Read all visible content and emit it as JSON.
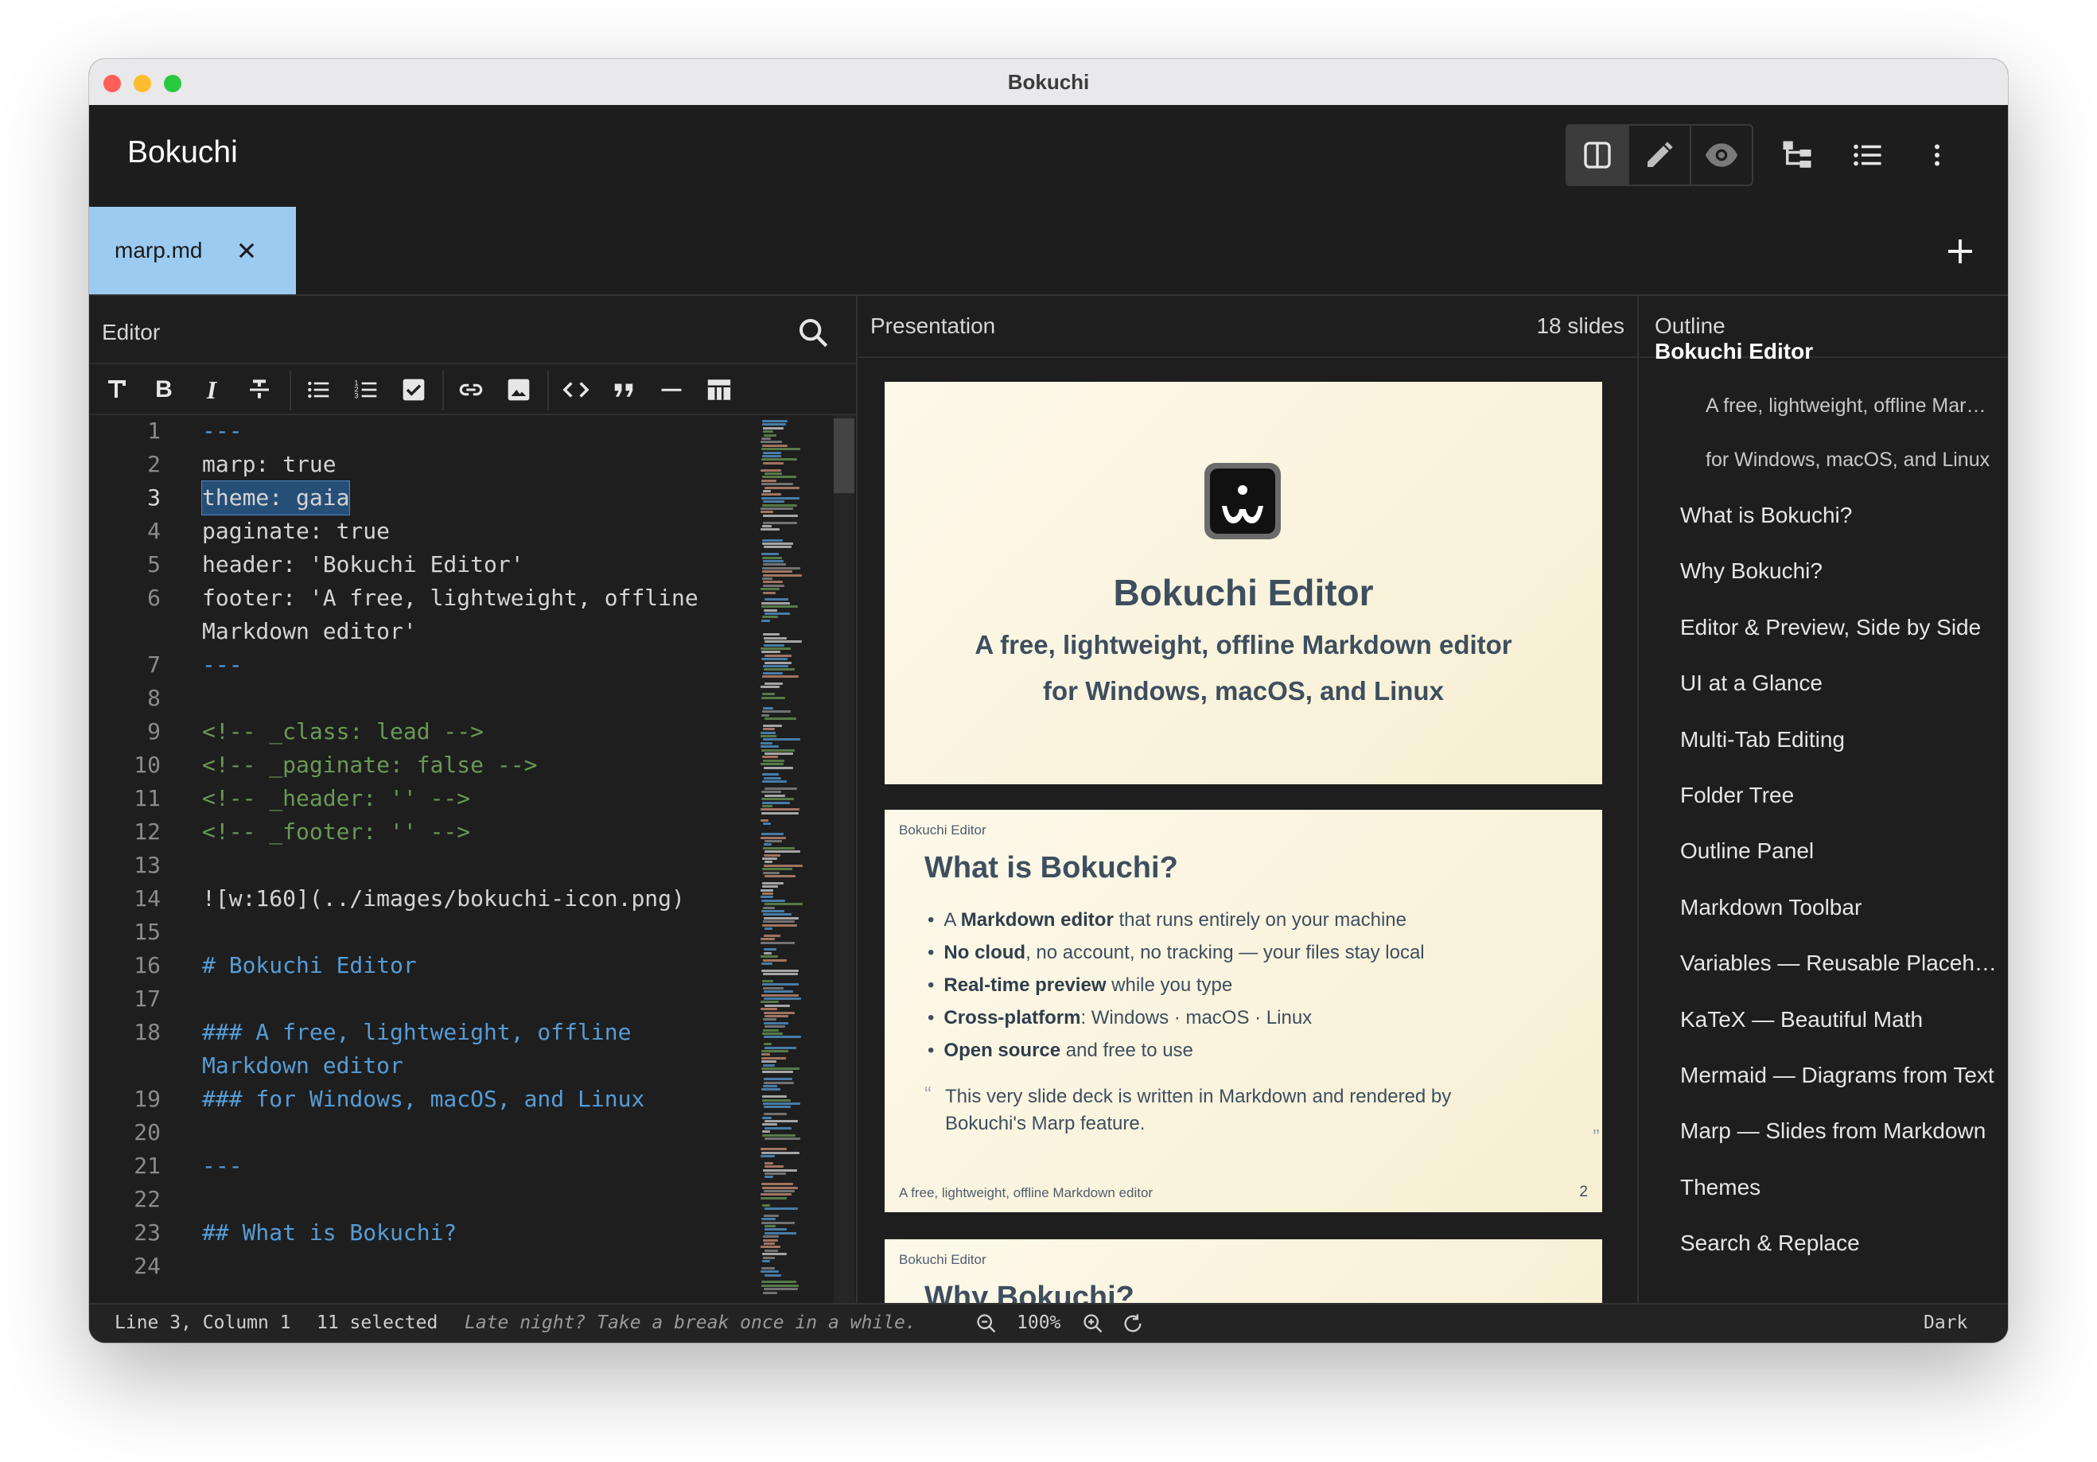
{
  "window": {
    "title": "Bokuchi"
  },
  "app": {
    "title": "Bokuchi"
  },
  "toolbar_icons": [
    "split-view-icon",
    "pencil-icon",
    "eye-icon",
    "folder-tree-icon",
    "outline-list-icon",
    "more-vertical-icon"
  ],
  "tabs": [
    {
      "label": "marp.md",
      "active": true
    }
  ],
  "editor": {
    "title": "Editor",
    "format_buttons": [
      "text-style-icon",
      "bold-icon",
      "italic-icon",
      "strikethrough-icon",
      "bullet-list-icon",
      "numbered-list-icon",
      "checkbox-icon",
      "link-icon",
      "image-icon",
      "code-icon",
      "quote-icon",
      "horizontal-rule-icon",
      "table-icon"
    ],
    "lines": [
      {
        "n": "1",
        "text": "---",
        "kind": "dash"
      },
      {
        "n": "2",
        "text": "marp: true",
        "kind": "plain"
      },
      {
        "n": "3",
        "text": "theme: gaia",
        "kind": "selected"
      },
      {
        "n": "4",
        "text": "paginate: true",
        "kind": "plain"
      },
      {
        "n": "5",
        "text": "header: 'Bokuchi Editor'",
        "kind": "plain"
      },
      {
        "n": "6",
        "text": "footer: 'A free, lightweight, offline",
        "kind": "plain"
      },
      {
        "n": "",
        "text": "Markdown editor'",
        "kind": "plain"
      },
      {
        "n": "7",
        "text": "---",
        "kind": "dash"
      },
      {
        "n": "8",
        "text": "",
        "kind": "plain"
      },
      {
        "n": "9",
        "text": "<!-- _class: lead -->",
        "kind": "comment"
      },
      {
        "n": "10",
        "text": "<!-- _paginate: false -->",
        "kind": "comment"
      },
      {
        "n": "11",
        "text": "<!-- _header: '' -->",
        "kind": "comment"
      },
      {
        "n": "12",
        "text": "<!-- _footer: '' -->",
        "kind": "comment"
      },
      {
        "n": "13",
        "text": "",
        "kind": "plain"
      },
      {
        "n": "14",
        "text": "![w:160](../images/bokuchi-icon.png)",
        "kind": "image"
      },
      {
        "n": "15",
        "text": "",
        "kind": "plain"
      },
      {
        "n": "16",
        "text": "# Bokuchi Editor",
        "kind": "head"
      },
      {
        "n": "17",
        "text": "",
        "kind": "plain"
      },
      {
        "n": "18",
        "text": "### A free, lightweight, offline",
        "kind": "head"
      },
      {
        "n": "",
        "text": "Markdown editor",
        "kind": "head"
      },
      {
        "n": "19",
        "text": "### for Windows, macOS, and Linux",
        "kind": "head"
      },
      {
        "n": "20",
        "text": "",
        "kind": "plain"
      },
      {
        "n": "21",
        "text": "---",
        "kind": "dash"
      },
      {
        "n": "22",
        "text": "",
        "kind": "plain"
      },
      {
        "n": "23",
        "text": "## What is Bokuchi?",
        "kind": "head"
      },
      {
        "n": "24",
        "text": "",
        "kind": "plain"
      }
    ]
  },
  "preview": {
    "title": "Presentation",
    "slide_count": "18 slides",
    "slide1": {
      "title": "Bokuchi Editor",
      "subtitle1": "A free, lightweight, offline Markdown editor",
      "subtitle2": "for Windows, macOS, and Linux"
    },
    "slide2": {
      "header": "Bokuchi Editor",
      "title": "What is Bokuchi?",
      "bullets": [
        {
          "bold": "Markdown editor",
          "pre": "A ",
          "post": " that runs entirely on your machine"
        },
        {
          "bold": "No cloud",
          "pre": "",
          "post": ", no account, no tracking — your files stay local"
        },
        {
          "bold": "Real-time preview",
          "pre": "",
          "post": " while you type"
        },
        {
          "bold": "Cross-platform",
          "pre": "",
          "post": ": Windows · macOS · Linux"
        },
        {
          "bold": "Open source",
          "pre": "",
          "post": " and free to use"
        }
      ],
      "quote_line1": "This very slide deck is written in Markdown and rendered by",
      "quote_line2": "Bokuchi's Marp feature.",
      "footer": "A free, lightweight, offline Markdown editor",
      "page": "2"
    },
    "slide3": {
      "header": "Bokuchi Editor",
      "title": "Why Bokuchi?"
    }
  },
  "outline": {
    "title": "Outline",
    "items": [
      {
        "label": "Bokuchi Editor",
        "level": 1
      },
      {
        "label": "A free, lightweight, offline Markdown editor",
        "level": 3
      },
      {
        "label": "for Windows, macOS, and Linux",
        "level": 3
      },
      {
        "label": "What is Bokuchi?",
        "level": 2
      },
      {
        "label": "Why Bokuchi?",
        "level": 2
      },
      {
        "label": "Editor & Preview, Side by Side",
        "level": 2
      },
      {
        "label": "UI at a Glance",
        "level": 2
      },
      {
        "label": "Multi-Tab Editing",
        "level": 2
      },
      {
        "label": "Folder Tree",
        "level": 2
      },
      {
        "label": "Outline Panel",
        "level": 2
      },
      {
        "label": "Markdown Toolbar",
        "level": 2
      },
      {
        "label": "Variables — Reusable Placeholders",
        "level": 2
      },
      {
        "label": "KaTeX — Beautiful Math",
        "level": 2
      },
      {
        "label": "Mermaid — Diagrams from Text",
        "level": 2
      },
      {
        "label": "Marp — Slides from Markdown",
        "level": 2
      },
      {
        "label": "Themes",
        "level": 2
      },
      {
        "label": "Search & Replace",
        "level": 2
      }
    ]
  },
  "status": {
    "position": "Line 3, Column 1",
    "selection": "11 selected",
    "message": "Late night? Take a break once in a while.",
    "zoom": "100%",
    "theme": "Dark"
  }
}
